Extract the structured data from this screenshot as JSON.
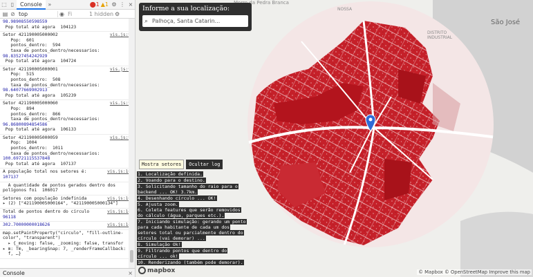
{
  "devtools": {
    "tabbar": {
      "tab_label": "Console",
      "more": "»",
      "errors": "1",
      "warnings": "1",
      "close": "×"
    },
    "toolbar": {
      "context": "top",
      "filter_placeholder": "Fi",
      "hidden": "1 hidden"
    },
    "log_entries": [
      {
        "lines": [
          "98.98908550598559",
          " Pop total até agora  104123"
        ]
      },
      {
        "source": "vis.js:93",
        "lines": [
          "Setor 421190005000002",
          "   Pop:  601",
          "   pontos_dentro:  594",
          "   taxa de pontos_dentro/necessarios:",
          "98.83527454242929",
          " Pop total até agora  104724"
        ]
      },
      {
        "source": "vis.js:93",
        "lines": [
          "Setor 421190005000001",
          "   Pop:  515",
          "   pontos_dentro:  508",
          "   taxa de pontos_dentro/necessarios:",
          "98.64077669902913",
          " Pop total até agora  105239"
        ]
      },
      {
        "source": "vis.js:93",
        "lines": [
          "Setor 421190005000060",
          "   Pop:  894",
          "   pontos_dentro:  866",
          "   taxa de pontos_dentro/necessarios:",
          "96.86800894854586",
          " Pop total até agora  106133"
        ]
      },
      {
        "source": "vis.js:93",
        "lines": [
          "Setor 421190005000059",
          "   Pop:  1004",
          "   pontos_dentro:  1011",
          "   taxa de pontos_dentro/necessarios:",
          "100.69721115537848",
          " Pop total até agora  107137"
        ]
      },
      {
        "source": "vis.js:104",
        "lines": [
          "A população total nos setores é:",
          "107137"
        ]
      },
      {
        "lines": [
          "  A quantidade de pontos gerados dentro dos",
          "polígonos foi  106017"
        ]
      },
      {
        "source": "vis.js:106",
        "lines": [
          "Setores com população indefinida",
          "▸ (2) [\"421190005000164\", \"421190005000134\"]"
        ]
      },
      {
        "source": "vis.js:144",
        "lines": [
          "Total de pontos dentro do círculo",
          "96118"
        ]
      },
      {
        "source": "vis.js:146",
        "lines": [
          "302.70000000018626"
        ]
      },
      {
        "lines": [
          "map.setPaintProperty(\"circulo\", \"fill-outline-",
          "color\", \"transparent\")",
          "  ▸ {_moving: false, _zooming: false, transfor",
          "▸ m: Tm, _bearingSnap: 7, _renderFrameCallback:",
          "  f, …}"
        ]
      }
    ],
    "drawer": {
      "label": "Console",
      "close": "×"
    }
  },
  "map": {
    "labels": {
      "top_center": "Morro da Pedra Branca",
      "sao_jose": "São José",
      "distrito": "DISTRITO INDUSTRIAL",
      "nossa": "NOSSA"
    },
    "panel": {
      "title": "Informe a sua localização:",
      "search_placeholder": "Palhoça, Santa Catarin..."
    },
    "buttons": {
      "show": "Mostra setores",
      "hide": "Ocultar log"
    },
    "steps": [
      "1. Localização definida.",
      "2. Voando para o destino.",
      "3. Solicitando tamanho do raio para o backend ... OK! 3.7km.",
      "4. Desenhando círculo ... OK!",
      "5. Ajusta zoom.",
      "6. Coleta features que serão removidos do cálculo (água, parques etc.).",
      "7. Iniciando simulação: gerando um ponto para cada habitante de cada um dos setores total ou parcialmente dentro do círculo (vai demorar) ...",
      "8. Simulação Ok!",
      "9. Filtrando pontos que dentro do círculo ... ok!",
      "10. Renderizando (também pode demorar)."
    ],
    "logo": "mapbox",
    "attribution": "© Mapbox © OpenStreetMap Improve this map",
    "colors": {
      "density": "#b3141d",
      "water": "#d2d2d2",
      "land": "#efefec",
      "marker": "#2f6bd6"
    }
  }
}
